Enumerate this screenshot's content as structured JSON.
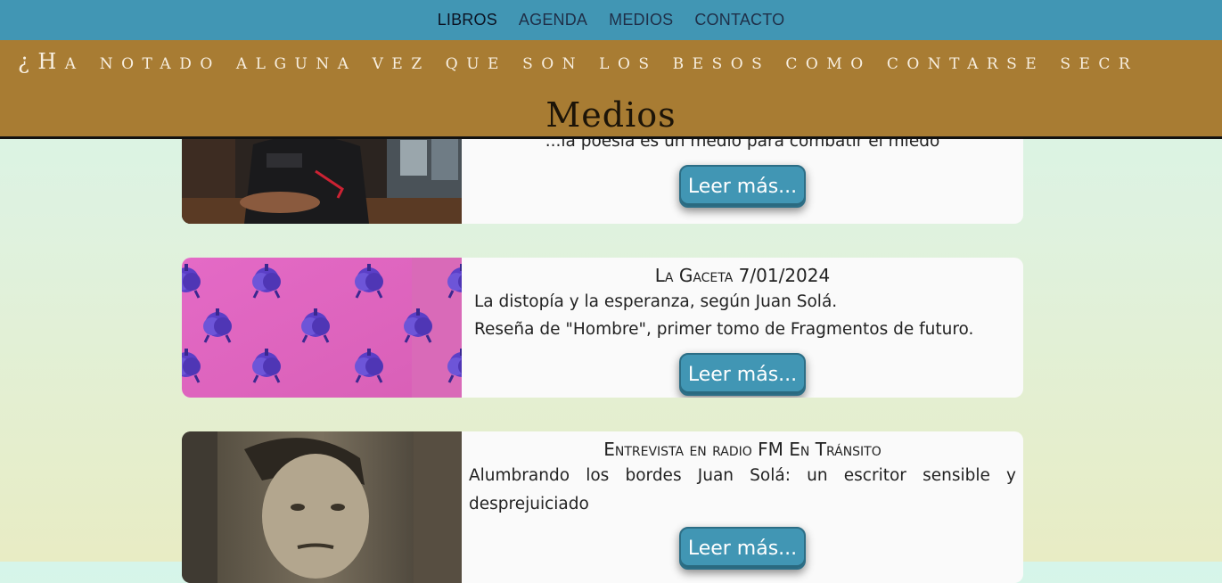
{
  "nav": {
    "items": [
      {
        "label": "LIBROS"
      },
      {
        "label": "AGENDA"
      },
      {
        "label": "MEDIOS"
      },
      {
        "label": "CONTACTO"
      }
    ]
  },
  "banner": {
    "marquee": "¿Ha notado alguna vez que son los besos como contarse secr",
    "section_title": "Medios"
  },
  "cards": [
    {
      "quote": "\"...la poesía es un medio para combatir el miedo\"",
      "button": "Leer más..."
    },
    {
      "title": "La Gaceta 7/01/2024",
      "lines": [
        "La distopía y la esperanza, según Juan Solá.",
        "Reseña de \"Hombre\", primer tomo de Fragmentos de futuro."
      ],
      "button": "Leer más..."
    },
    {
      "title": "Entrevista en radio FM En Tránsito",
      "text": "Alumbrando los bordes Juan Solá: un escritor sensible y desprejuiciado",
      "button": "Leer más..."
    }
  ],
  "colors": {
    "nav_bg": "#4196b4",
    "banner_bg": "#a87c33",
    "button_bg": "#4196b4"
  }
}
